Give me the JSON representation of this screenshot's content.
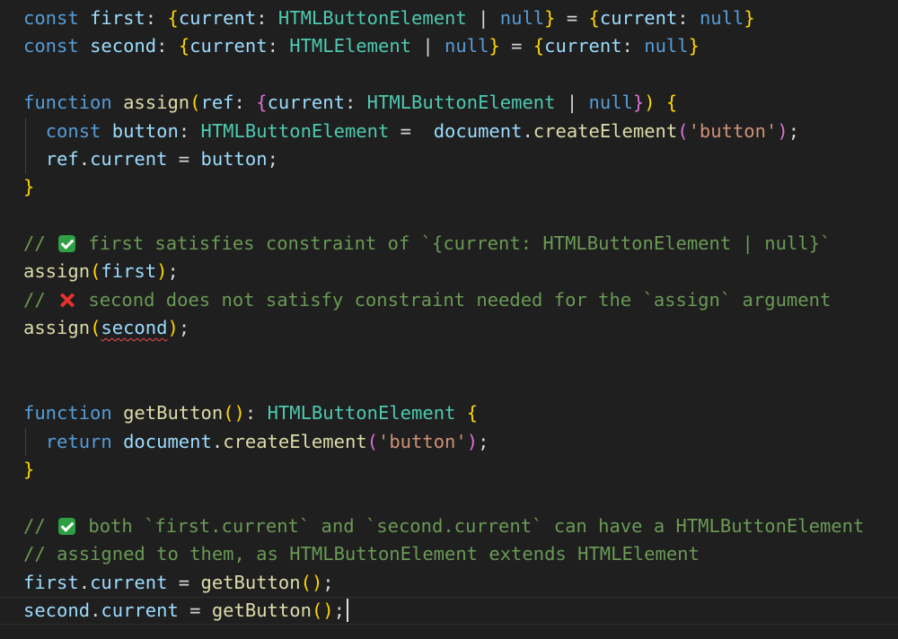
{
  "editor": {
    "lines": {
      "l1": {
        "const": "const",
        "first": "first",
        "colon": ": ",
        "ob": "{",
        "prop": "current",
        "colon2": ": ",
        "type": "HTMLButtonElement",
        "pipe": " | ",
        "nul": "null",
        "cb": "}",
        "eq": " = ",
        "ob2": "{",
        "prop2": "current",
        "colon3": ": ",
        "nul2": "null",
        "cb2": "}"
      },
      "l2": {
        "const": "const",
        "second": "second",
        "colon": ": ",
        "ob": "{",
        "prop": "current",
        "colon2": ": ",
        "type": "HTMLElement",
        "pipe": " | ",
        "nul": "null",
        "cb": "}",
        "eq": " = ",
        "ob2": "{",
        "prop2": "current",
        "colon3": ": ",
        "nul2": "null",
        "cb2": "}"
      },
      "l4": {
        "function": "function",
        "name": "assign",
        "op": "(",
        "ref": "ref",
        "colon": ": ",
        "ob": "{",
        "prop": "current",
        "colon2": ": ",
        "type": "HTMLButtonElement",
        "pipe": " | ",
        "nul": "null",
        "cb": "}",
        "cp": ")",
        "sp": " ",
        "brace": "{"
      },
      "l5": {
        "const": "const",
        "button": "button",
        "colon": ": ",
        "type": "HTMLButtonElement",
        "eq": " =  ",
        "document": "document",
        "dot": ".",
        "method": "createElement",
        "op": "(",
        "str": "'button'",
        "cp": ")",
        "semi": ";"
      },
      "l6": {
        "ref": "ref",
        "dot": ".",
        "prop": "current",
        "eq": " = ",
        "button": "button",
        "semi": ";"
      },
      "l7": {
        "brace": "}"
      },
      "l9": {
        "prefix": "// ",
        "text": " first satisfies constraint of `{current: HTMLButtonElement | null}`"
      },
      "l10": {
        "fn": "assign",
        "op": "(",
        "arg": "first",
        "cp": ")",
        "semi": ";"
      },
      "l11": {
        "prefix": "// ",
        "text": " second does not satisfy constraint needed for the `assign` argument"
      },
      "l12": {
        "fn": "assign",
        "op": "(",
        "arg": "second",
        "cp": ")",
        "semi": ";"
      },
      "l15": {
        "function": "function",
        "name": "getButton",
        "op": "(",
        "cp": ")",
        "colon": ": ",
        "type": "HTMLButtonElement",
        "sp": " ",
        "brace": "{"
      },
      "l16": {
        "return": "return",
        "sp": " ",
        "document": "document",
        "dot": ".",
        "method": "createElement",
        "op": "(",
        "str": "'button'",
        "cp": ")",
        "semi": ";"
      },
      "l17": {
        "brace": "}"
      },
      "l19": {
        "prefix": "// ",
        "text": " both `first.current` and `second.current` can have a HTMLButtonElement"
      },
      "l20": {
        "text": "// assigned to them, as HTMLButtonElement extends HTMLElement"
      },
      "l21": {
        "obj": "first",
        "dot": ".",
        "prop": "current",
        "eq": " = ",
        "fn": "getButton",
        "op": "(",
        "cp": ")",
        "semi": ";"
      },
      "l22": {
        "obj": "second",
        "dot": ".",
        "prop": "current",
        "eq": " = ",
        "fn": "getButton",
        "op": "(",
        "cp": ")",
        "semi": ";"
      }
    }
  }
}
